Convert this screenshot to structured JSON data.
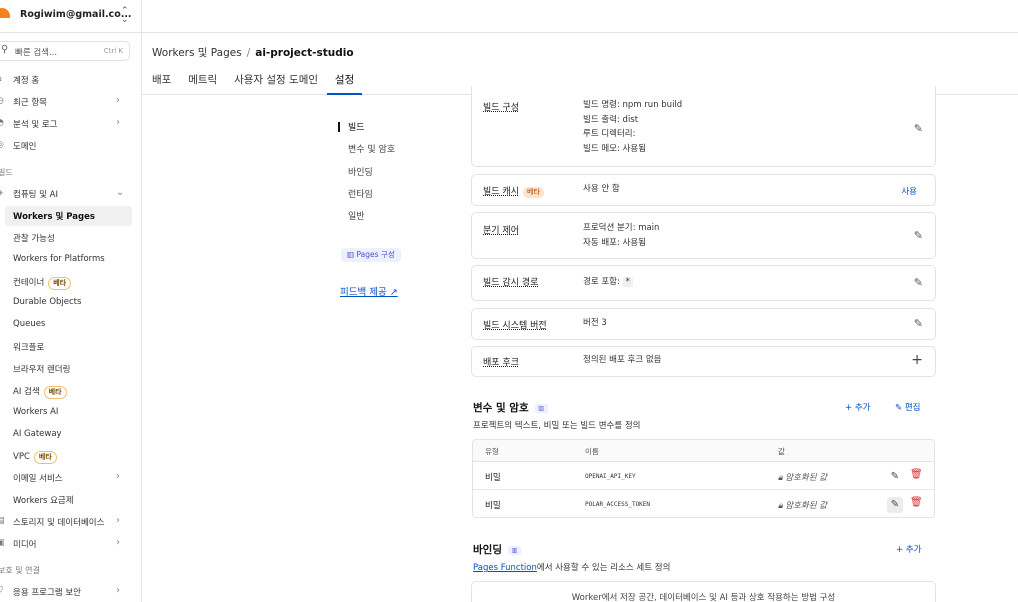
{
  "sidebar": {
    "account_email": "Rogiwim@gmail.co...",
    "search_placeholder": "빠른 검색...",
    "search_shortcut": "Ctrl K",
    "items": [
      {
        "label": "계정 홈"
      },
      {
        "label": "최근 항목"
      },
      {
        "label": "분석 및 로그"
      },
      {
        "label": "도메인"
      }
    ],
    "section_build": "빌드",
    "compute_group": "컴퓨팅 및 AI",
    "compute_items": [
      {
        "label": "Workers 및 Pages"
      },
      {
        "label": "관찰 가능성"
      },
      {
        "label": "Workers for Platforms"
      },
      {
        "label": "컨테이너",
        "badge": "베타"
      },
      {
        "label": "Durable Objects"
      },
      {
        "label": "Queues"
      },
      {
        "label": "워크플로"
      },
      {
        "label": "브라우저 렌더링"
      },
      {
        "label": "AI 검색",
        "badge": "베타"
      },
      {
        "label": "Workers AI"
      },
      {
        "label": "AI Gateway"
      },
      {
        "label": "VPC",
        "badge": "베타"
      },
      {
        "label": "이메일 서비스"
      },
      {
        "label": "Workers 요금제"
      }
    ],
    "storage_group": "스토리지 및 데이터베이스",
    "media_group": "미디어",
    "section_protect": "보호 및 연결",
    "app_security": "응용 프로그램 보안"
  },
  "header": {
    "crumb_parent": "Workers 및 Pages",
    "crumb_sep": "/",
    "crumb_current": "ai-project-studio",
    "tabs": [
      "배포",
      "메트릭",
      "사용자 설정 도메인",
      "설정"
    ]
  },
  "pagenav": {
    "items": [
      "빌드",
      "변수 및 암호",
      "바인딩",
      "런타임",
      "일반"
    ],
    "pages_badge": "Pages 구성",
    "feedback": "피드백 제공"
  },
  "build": {
    "config_label": "빌드 구성",
    "config_lines": [
      "빌드 명령: npm run build",
      "빌드 출력: dist",
      "루트 디렉터리:",
      "빌드 메모: 사용됨"
    ],
    "cache_label": "빌드 캐시",
    "cache_badge": "베타",
    "cache_value": "사용 안 함",
    "cache_action": "사용",
    "branch_label": "분기 제어",
    "branch_lines": [
      "프로덕션 분기: main",
      "자동 배포: 사용됨"
    ],
    "watch_label": "빌드 감시 경로",
    "watch_prefix": "경로 포함:",
    "watch_value": "*",
    "system_label": "빌드 시스템 버전",
    "system_value": "버전 3",
    "hook_label": "배포 후크",
    "hook_value": "정의된 배포 후크 없음"
  },
  "variables": {
    "title": "변수 및 암호",
    "desc": "프로젝트의 텍스트, 비밀 또는 빌드 변수를 정의",
    "add": "+ 추가",
    "edit": "편집",
    "columns": [
      "유형",
      "이름",
      "값"
    ],
    "rows": [
      {
        "type": "비밀",
        "name": "OPENAI_API_KEY",
        "value": "암호화된 값"
      },
      {
        "type": "비밀",
        "name": "POLAR_ACCESS_TOKEN",
        "value": "암호화된 값"
      }
    ]
  },
  "bindings": {
    "title": "바인딩",
    "desc_link": "Pages Function",
    "desc_rest": "에서 사용할 수 있는 리소스 세트 정의",
    "add": "+ 추가",
    "empty": "Worker에서 저장 공간, 데이터베이스 및 AI 등과 상호 작용하는 방법 구성"
  }
}
